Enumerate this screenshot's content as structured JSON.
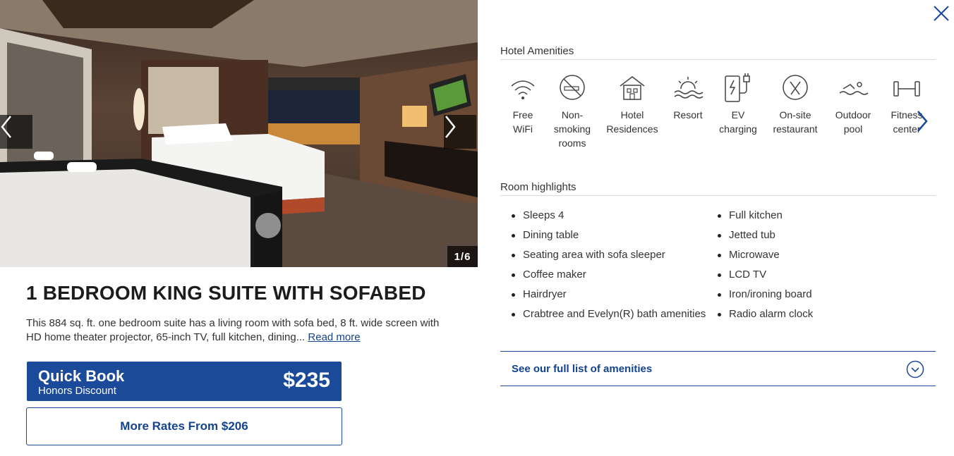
{
  "gallery": {
    "counter": "1/6",
    "prev_icon": "chevron-left-icon",
    "next_icon": "chevron-right-icon"
  },
  "room": {
    "title": "1 BEDROOM KING SUITE WITH SOFABED",
    "description": "This 884 sq. ft. one bedroom suite has a living room with sofa bed, 8 ft. wide screen with HD home theater projector, 65-inch TV, full kitchen, dining...",
    "read_more": "Read more"
  },
  "quick_book": {
    "title": "Quick Book",
    "subtitle": "Honors Discount",
    "price": "$235"
  },
  "more_rates": "More Rates From $206",
  "amenities": {
    "heading": "Hotel Amenities",
    "items": [
      {
        "icon": "wifi-icon",
        "label": "Free WiFi"
      },
      {
        "icon": "no-smoking-icon",
        "label": "Non-smoking rooms"
      },
      {
        "icon": "hotel-residences-icon",
        "label": "Hotel Residences"
      },
      {
        "icon": "resort-icon",
        "label": "Resort"
      },
      {
        "icon": "ev-charging-icon",
        "label": "EV charging"
      },
      {
        "icon": "restaurant-icon",
        "label": "On-site restaurant"
      },
      {
        "icon": "pool-icon",
        "label": "Outdoor pool"
      },
      {
        "icon": "fitness-icon",
        "label": "Fitness center"
      }
    ]
  },
  "highlights": {
    "heading": "Room highlights",
    "left": [
      "Sleeps 4",
      "Dining table",
      "Seating area with sofa sleeper",
      "Coffee maker",
      "Hairdryer",
      "Crabtree and Evelyn(R) bath amenities"
    ],
    "right": [
      "Full kitchen",
      "Jetted tub",
      "Microwave",
      "LCD TV",
      "Iron/ironing board",
      "Radio alarm clock"
    ]
  },
  "full_list": "See our full list of amenities",
  "colors": {
    "brand": "#1a4a99",
    "link": "#14448e"
  }
}
